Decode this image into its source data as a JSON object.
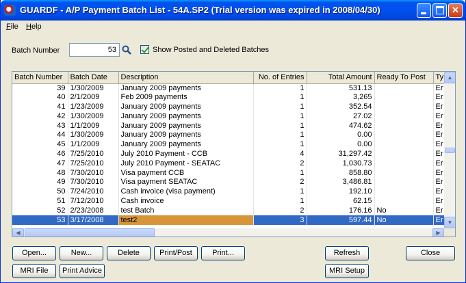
{
  "window": {
    "title": "GUARDF - A/P Payment Batch List - 54A.SP2  (Trial version was expired in 2008/04/30)"
  },
  "menu": {
    "file": "File",
    "help": "Help"
  },
  "filter": {
    "batch_label": "Batch Number",
    "batch_value": "53",
    "show_posted_label": "Show Posted and Deleted Batches",
    "show_posted_checked": true
  },
  "grid": {
    "columns": [
      "Batch Number",
      "Batch Date",
      "Description",
      "No. of Entries",
      "Total Amount",
      "Ready To Post",
      "Ty"
    ],
    "rows": [
      [
        "39",
        "1/30/2009",
        "January 2009 payments",
        "1",
        "531.13",
        "",
        "Er"
      ],
      [
        "40",
        "2/1/2009",
        "Feb 2009 payments",
        "1",
        "3,265",
        "",
        "Er"
      ],
      [
        "41",
        "1/23/2009",
        "January 2009 payments",
        "1",
        "352.54",
        "",
        "Er"
      ],
      [
        "42",
        "1/30/2009",
        "January 2009 payments",
        "1",
        "27.02",
        "",
        "Er"
      ],
      [
        "43",
        "1/1/2009",
        "January 2009 payments",
        "1",
        "474.62",
        "",
        "Er"
      ],
      [
        "44",
        "1/30/2009",
        "January 2009 payments",
        "1",
        "0.00",
        "",
        "Er"
      ],
      [
        "45",
        "1/1/2009",
        "January 2009 payments",
        "1",
        "0.00",
        "",
        "Er"
      ],
      [
        "46",
        "7/25/2010",
        "July 2010 Payment - CCB",
        "4",
        "31,297.42",
        "",
        "Er"
      ],
      [
        "47",
        "7/25/2010",
        "July 2010 Payment - SEATAC",
        "2",
        "1,030.73",
        "",
        "Er"
      ],
      [
        "48",
        "7/30/2010",
        "Visa payment CCB",
        "1",
        "858.80",
        "",
        "Er"
      ],
      [
        "49",
        "7/30/2010",
        "Visa payment SEATAC",
        "2",
        "3,486.81",
        "",
        "Er"
      ],
      [
        "50",
        "7/24/2010",
        "Cash invoice (visa payment)",
        "1",
        "192.10",
        "",
        "Er"
      ],
      [
        "51",
        "7/12/2010",
        "Cash invoice",
        "1",
        "62.15",
        "",
        "Er"
      ],
      [
        "52",
        "2/23/2008",
        "test Batch",
        "2",
        "176.16",
        "No",
        "Er"
      ],
      [
        "53",
        "3/17/2008",
        "test2",
        "3",
        "597.44",
        "No",
        "Er"
      ]
    ],
    "selected_index": 14
  },
  "buttons": {
    "open": "Open...",
    "new": "New...",
    "delete": "Delete",
    "print_post": "Print/Post",
    "print": "Print...",
    "refresh": "Refresh",
    "close": "Close",
    "mri_file": "MRI File",
    "print_advice": "Print Advice",
    "mri_setup": "MRI Setup"
  }
}
